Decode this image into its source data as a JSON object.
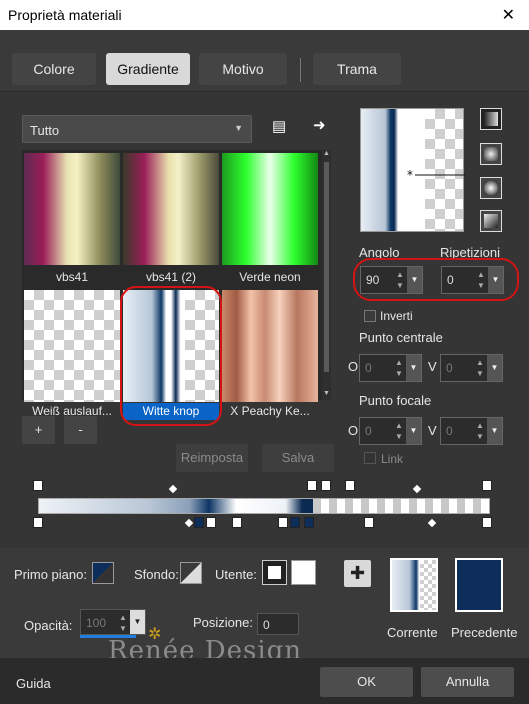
{
  "window": {
    "title": "Proprietà materiali"
  },
  "tabs": [
    "Colore",
    "Gradiente",
    "Motivo",
    "Trama"
  ],
  "category": {
    "selected": "Tutto"
  },
  "gradients": [
    {
      "label": "vbs41"
    },
    {
      "label": "vbs41 (2)"
    },
    {
      "label": "Verde neon"
    },
    {
      "label": "Weiß auslauf..."
    },
    {
      "label": "Witte knop",
      "selected": true
    },
    {
      "label": "X Peachy Ke..."
    }
  ],
  "buttons": {
    "reset": "Reimposta",
    "save": "Salva",
    "add": "+",
    "remove": "-",
    "ok": "OK",
    "cancel": "Annulla",
    "help": "Guida"
  },
  "angle": {
    "label": "Angolo",
    "value": "90"
  },
  "repeats": {
    "label": "Ripetizioni",
    "value": "0"
  },
  "invert": {
    "label": "Inverti",
    "checked": false
  },
  "center": {
    "label": "Punto centrale",
    "o_label": "O",
    "o_value": "0",
    "v_label": "V",
    "v_value": "0"
  },
  "focal": {
    "label": "Punto focale",
    "o_label": "O",
    "o_value": "0",
    "v_label": "V",
    "v_value": "0"
  },
  "link": {
    "label": "Link",
    "checked": false
  },
  "stop_editor": {
    "foreground_label": "Primo piano:",
    "background_label": "Sfondo:",
    "user_label": "Utente:",
    "opacity_label": "Opacità:",
    "opacity_value": "100",
    "position_label": "Posizione:",
    "position_value": "0"
  },
  "current": {
    "label": "Corrente"
  },
  "previous": {
    "label": "Precedente",
    "color": "#0d2d5a"
  },
  "watermark": "Renée Design",
  "colors": {
    "accent": "#0a64c8",
    "highlight_ring": "#d41414"
  }
}
